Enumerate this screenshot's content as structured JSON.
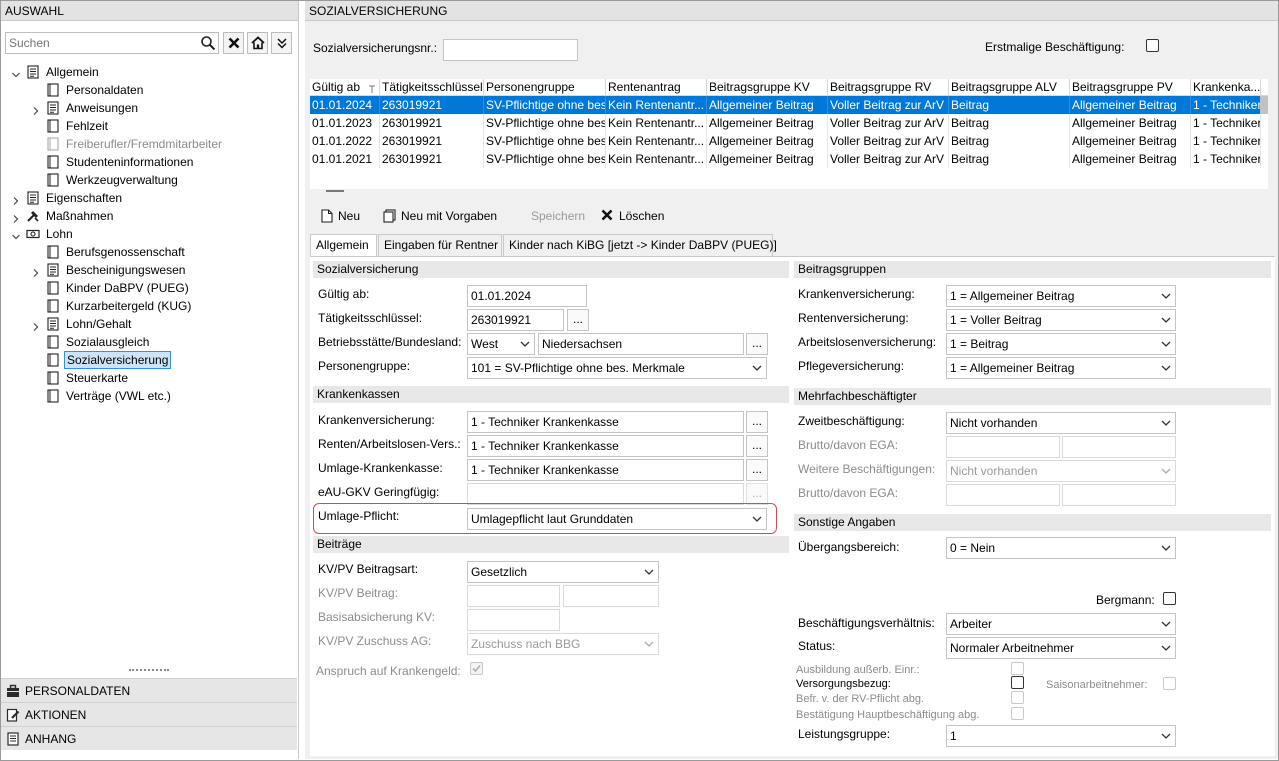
{
  "left": {
    "title": "AUSWAHL",
    "search_placeholder": "Suchen",
    "tree": [
      {
        "label": "Allgemein",
        "level": 0,
        "expander": "open",
        "icon": "list"
      },
      {
        "label": "Personaldaten",
        "level": 1,
        "icon": "doc"
      },
      {
        "label": "Anweisungen",
        "level": 1,
        "expander": "closed",
        "icon": "list"
      },
      {
        "label": "Fehlzeit",
        "level": 1,
        "icon": "doc"
      },
      {
        "label": "Freiberufler/Fremdmitarbeiter",
        "level": 1,
        "icon": "doc-dis",
        "disabled": true
      },
      {
        "label": "Studenteninformationen",
        "level": 1,
        "icon": "doc"
      },
      {
        "label": "Werkzeugverwaltung",
        "level": 1,
        "icon": "doc"
      },
      {
        "label": "Eigenschaften",
        "level": 0,
        "expander": "closed",
        "icon": "list"
      },
      {
        "label": "Maßnahmen",
        "level": 0,
        "expander": "closed",
        "icon": "tools"
      },
      {
        "label": "Lohn",
        "level": 0,
        "expander": "open",
        "icon": "money"
      },
      {
        "label": "Berufsgenossenschaft",
        "level": 1,
        "icon": "doc"
      },
      {
        "label": "Bescheinigungswesen",
        "level": 1,
        "expander": "closed",
        "icon": "list"
      },
      {
        "label": "Kinder DaBPV (PUEG)",
        "level": 1,
        "icon": "doc"
      },
      {
        "label": "Kurzarbeitergeld (KUG)",
        "level": 1,
        "icon": "doc"
      },
      {
        "label": "Lohn/Gehalt",
        "level": 1,
        "expander": "closed",
        "icon": "list"
      },
      {
        "label": "Sozialausgleich",
        "level": 1,
        "icon": "doc"
      },
      {
        "label": "Sozialversicherung",
        "level": 1,
        "icon": "doc",
        "selected": true
      },
      {
        "label": "Steuerkarte",
        "level": 1,
        "icon": "doc"
      },
      {
        "label": "Verträge (VWL etc.)",
        "level": 1,
        "icon": "doc"
      }
    ],
    "bottom_nav": [
      "PERSONALDATEN",
      "AKTIONEN",
      "ANHANG"
    ]
  },
  "right": {
    "title": "SOZIALVERSICHERUNG",
    "svnr_label": "Sozialversicherungsnr.:",
    "svnr_value": "",
    "erstmalig_label": "Erstmalige Beschäftigung:",
    "grid": {
      "columns": [
        "Gültig ab",
        "Tätigkeitsschlüssel",
        "Personengruppe",
        "Rentenantrag",
        "Beitragsgruppe KV",
        "Beitragsgruppe RV",
        "Beitragsgruppe ALV",
        "Beitragsgruppe PV",
        "Krankenka..."
      ],
      "rows": [
        [
          "01.01.2024",
          "263019921",
          "SV-Pflichtige ohne bes",
          "Kein Rentenantr...",
          "Allgemeiner Beitrag",
          "Voller Beitrag zur ArV",
          "Beitrag",
          "Allgemeiner Beitrag",
          "1 - Techniker"
        ],
        [
          "01.01.2023",
          "263019921",
          "SV-Pflichtige ohne bes",
          "Kein Rentenantr...",
          "Allgemeiner Beitrag",
          "Voller Beitrag zur ArV",
          "Beitrag",
          "Allgemeiner Beitrag",
          "1 - Techniker"
        ],
        [
          "01.01.2022",
          "263019921",
          "SV-Pflichtige ohne bes",
          "Kein Rentenantr...",
          "Allgemeiner Beitrag",
          "Voller Beitrag zur ArV",
          "Beitrag",
          "Allgemeiner Beitrag",
          "1 - Techniker"
        ],
        [
          "01.01.2021",
          "263019921",
          "SV-Pflichtige ohne bes",
          "Kein Rentenantr...",
          "Allgemeiner Beitrag",
          "Voller Beitrag zur ArV",
          "Beitrag",
          "Allgemeiner Beitrag",
          "1 - Techniker"
        ]
      ]
    },
    "toolbar": {
      "neu": "Neu",
      "neu_vorgaben": "Neu mit Vorgaben",
      "speichern": "Speichern",
      "loeschen": "Löschen"
    },
    "tabs": [
      "Allgemein",
      "Eingaben für Rentner",
      "Kinder nach KiBG [jetzt -> Kinder DaBPV (PUEG)]"
    ],
    "sv": {
      "section": "Sozialversicherung",
      "gueltig_label": "Gültig ab:",
      "gueltig_value": "01.01.2024",
      "taetig_label": "Tätigkeitsschlüssel:",
      "taetig_value": "263019921",
      "betrieb_label": "Betriebsstätte/Bundesland:",
      "betrieb_region": "West",
      "betrieb_land": "Niedersachsen",
      "personen_label": "Personengruppe:",
      "personen_value": "101 = SV-Pflichtige ohne bes. Merkmale"
    },
    "kk": {
      "section": "Krankenkassen",
      "kv_label": "Krankenversicherung:",
      "kv_value": "1 - Techniker Krankenkasse",
      "rv_label": "Renten/Arbeitslosen-Vers.:",
      "rv_value": "1 - Techniker Krankenkasse",
      "umlage_kk_label": "Umlage-Krankenkasse:",
      "umlage_kk_value": "1 - Techniker Krankenkasse",
      "eau_label": "eAU-GKV Geringfügig:",
      "eau_value": "",
      "umlage_pflicht_label": "Umlage-Pflicht:",
      "umlage_pflicht_value": "Umlagepflicht laut Grunddaten"
    },
    "beitraege": {
      "section": "Beiträge",
      "art_label": "KV/PV Beitragsart:",
      "art_value": "Gesetzlich",
      "beitrag_label": "KV/PV Beitrag:",
      "basis_label": "Basisabsicherung KV:",
      "zuschuss_label": "KV/PV Zuschuss AG:",
      "zuschuss_value": "Zuschuss nach BBG",
      "anspruch_label": "Anspruch auf Krankengeld:"
    },
    "bg": {
      "section": "Beitragsgruppen",
      "kv_label": "Krankenversicherung:",
      "kv_value": "1 = Allgemeiner Beitrag",
      "rv_label": "Rentenversicherung:",
      "rv_value": "1 = Voller Beitrag",
      "alv_label": "Arbeitslosenversicherung:",
      "alv_value": "1 = Beitrag",
      "pv_label": "Pflegeversicherung:",
      "pv_value": "1 = Allgemeiner Beitrag"
    },
    "mb": {
      "section": "Mehrfachbeschäftigter",
      "zweit_label": "Zweitbeschäftigung:",
      "zweit_value": "Nicht vorhanden",
      "brutto1_label": "Brutto/davon EGA:",
      "weitere_label": "Weitere Beschäftigungen:",
      "weitere_value": "Nicht vorhanden",
      "brutto2_label": "Brutto/davon EGA:"
    },
    "sonst": {
      "section": "Sonstige Angaben",
      "ueber_label": "Übergangsbereich:",
      "ueber_value": "0 = Nein",
      "bergmann_label": "Bergmann:",
      "besch_label": "Beschäftigungsverhältnis:",
      "besch_value": "Arbeiter",
      "status_label": "Status:",
      "status_value": "Normaler Arbeitnehmer",
      "ausbildung_label": "Ausbildung außerb. Einr.:",
      "versorgung_label": "Versorgungsbezug:",
      "saison_label": "Saisonarbeitnehmer:",
      "befr_label": "Befr. v. der RV-Pflicht abg.",
      "bestaetigung_label": "Bestätigung Hauptbeschäftigung abg.",
      "leistung_label": "Leistungsgruppe:",
      "leistung_value": "1"
    }
  }
}
